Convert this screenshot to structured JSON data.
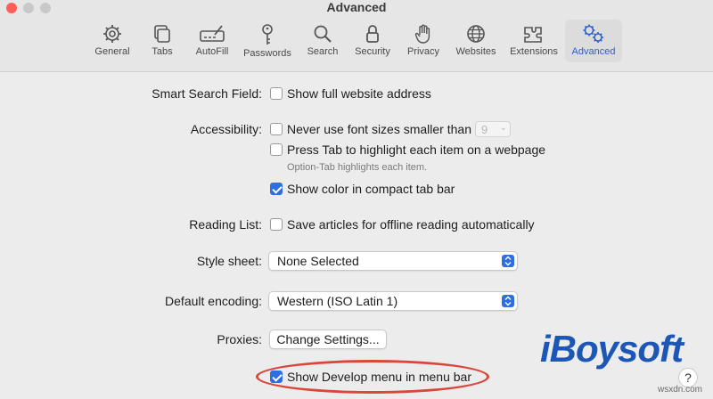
{
  "window": {
    "title": "Advanced",
    "traffic_lights": [
      "#ff5f57",
      "#c8c8c8",
      "#c8c8c8"
    ]
  },
  "toolbar": {
    "tabs": [
      {
        "label": "General",
        "icon": "gear-icon"
      },
      {
        "label": "Tabs",
        "icon": "tabs-icon"
      },
      {
        "label": "AutoFill",
        "icon": "autofill-icon"
      },
      {
        "label": "Passwords",
        "icon": "key-icon"
      },
      {
        "label": "Search",
        "icon": "search-icon"
      },
      {
        "label": "Security",
        "icon": "lock-icon"
      },
      {
        "label": "Privacy",
        "icon": "hand-icon"
      },
      {
        "label": "Websites",
        "icon": "globe-icon"
      },
      {
        "label": "Extensions",
        "icon": "puzzle-icon"
      },
      {
        "label": "Advanced",
        "icon": "gears-icon",
        "active": true
      }
    ],
    "accent_color": "#2a62c9"
  },
  "settings": {
    "smart_search": {
      "label": "Smart Search Field:",
      "option": "Show full website address",
      "checked": false
    },
    "accessibility": {
      "label": "Accessibility:",
      "font_size_option": "Never use font sizes smaller than",
      "font_size_checked": false,
      "font_size_value": "9",
      "tab_option": "Press Tab to highlight each item on a webpage",
      "tab_checked": false,
      "tab_hint": "Option-Tab highlights each item.",
      "compact_color_option": "Show color in compact tab bar",
      "compact_color_checked": true
    },
    "reading_list": {
      "label": "Reading List:",
      "option": "Save articles for offline reading automatically",
      "checked": false
    },
    "style_sheet": {
      "label": "Style sheet:",
      "value": "None Selected"
    },
    "default_encoding": {
      "label": "Default encoding:",
      "value": "Western (ISO Latin 1)"
    },
    "proxies": {
      "label": "Proxies:",
      "button": "Change Settings..."
    },
    "develop_menu": {
      "option": "Show Develop menu in menu bar",
      "checked": true
    }
  },
  "help_button": "?",
  "branding": {
    "logo_text": "iBoysoft",
    "watermark": "wsxdn.com",
    "highlight_color": "#d9463a"
  }
}
